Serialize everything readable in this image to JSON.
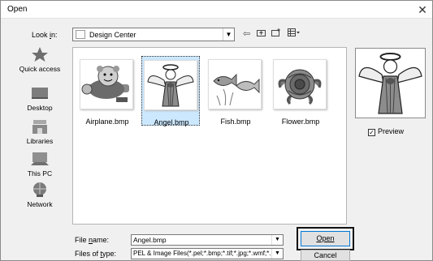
{
  "window": {
    "title": "Open",
    "close_glyph": "✕"
  },
  "lookin": {
    "label": "Look in:",
    "value": "Design Center"
  },
  "places": [
    {
      "label": "Quick access",
      "icon": "quick-access-icon"
    },
    {
      "label": "Desktop",
      "icon": "desktop-icon"
    },
    {
      "label": "Libraries",
      "icon": "libraries-icon"
    },
    {
      "label": "This PC",
      "icon": "this-pc-icon"
    },
    {
      "label": "Network",
      "icon": "network-icon"
    }
  ],
  "files": [
    {
      "name": "Airplane.bmp",
      "selected": false
    },
    {
      "name": "Angel.bmp",
      "selected": true
    },
    {
      "name": "Fish.bmp",
      "selected": false
    },
    {
      "name": "Flower.bmp",
      "selected": false
    }
  ],
  "preview": {
    "label": "Preview",
    "checked": true
  },
  "filename": {
    "label": "File name:",
    "value": "Angel.bmp"
  },
  "filetype": {
    "label": "Files of type:",
    "value": "PEL & Image Files(*.pel;*.bmp;*.tif;*.jpg;*.wmf;*.p"
  },
  "buttons": {
    "open": "Open",
    "cancel": "Cancel"
  },
  "colors": {
    "accent": "#0078d7",
    "selection": "#cce8ff"
  }
}
